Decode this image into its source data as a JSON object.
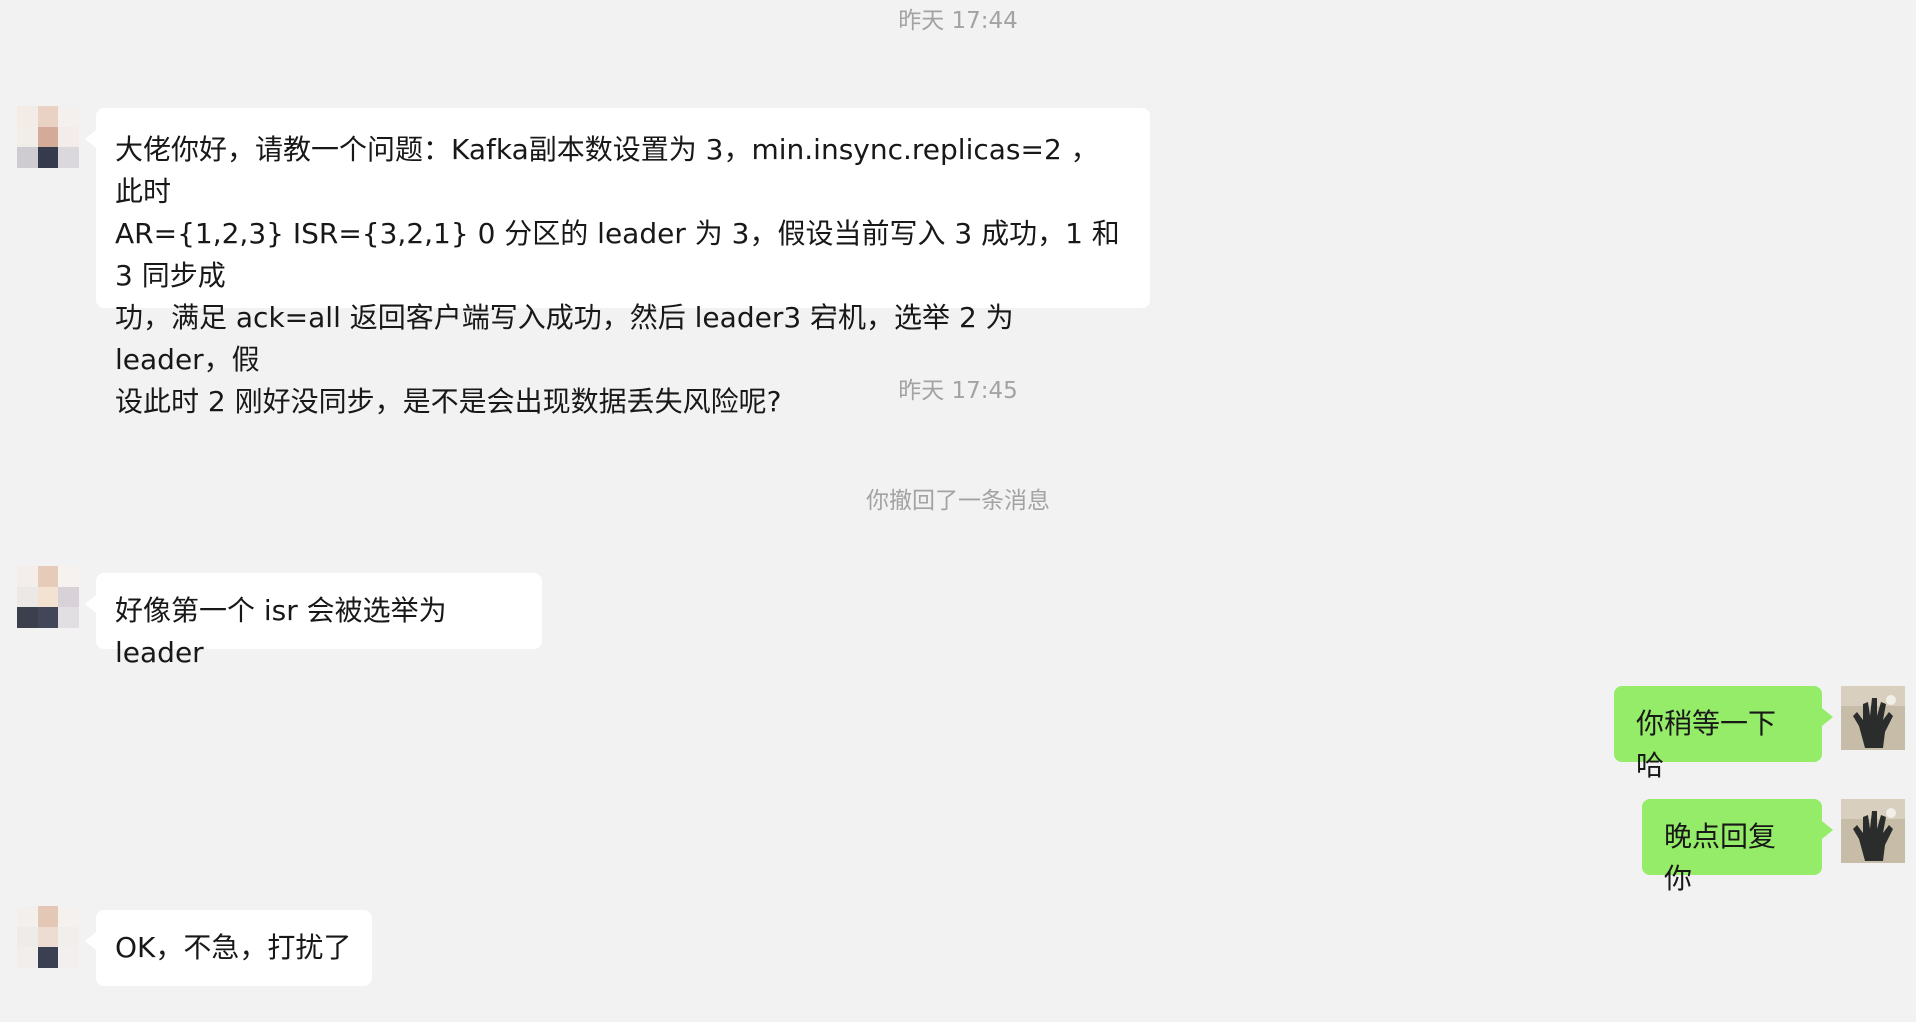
{
  "chat": {
    "timestamp_1": "昨天 17:44",
    "timestamp_2": "昨天 17:45",
    "system_recall": "你撤回了一条消息",
    "messages": [
      {
        "side": "left",
        "text": "大佬你好，请教一个问题：Kafka副本数设置为 3，min.insync.replicas=2 ， 此时\nAR={1,2,3} ISR={3,2,1} 0 分区的 leader 为 3，假设当前写入 3 成功，1 和 3 同步成\n功，满足 ack=all 返回客户端写入成功，然后 leader3 宕机，选举 2 为 leader，假\n设此时 2 刚好没同步，是不是会出现数据丢失风险呢?"
      },
      {
        "side": "left",
        "text": "好像第一个 isr 会被选举为 leader"
      },
      {
        "side": "right",
        "text": "你稍等一下哈"
      },
      {
        "side": "right",
        "text": "晚点回复你"
      },
      {
        "side": "left",
        "text": "OK，不急，打扰了"
      }
    ]
  },
  "colors": {
    "background": "#f2f2f2",
    "incoming_bubble": "#ffffff",
    "outgoing_bubble": "#95ec69",
    "meta_text": "#a3a3a3",
    "body_text": "#181818"
  },
  "icons": {
    "contact_avatar": "contact-avatar-icon",
    "self_avatar": "self-avatar-icon"
  }
}
